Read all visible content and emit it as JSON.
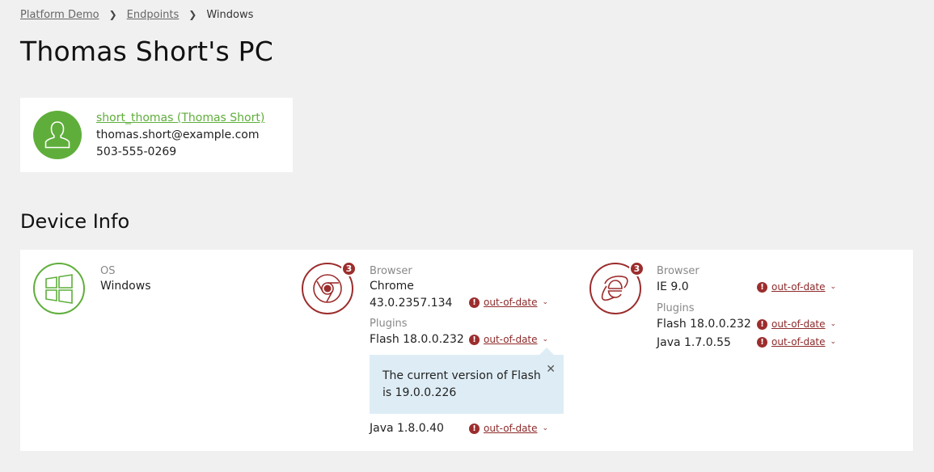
{
  "breadcrumb": {
    "items": [
      "Platform Demo",
      "Endpoints"
    ],
    "current": "Windows"
  },
  "page_title": "Thomas Short's PC",
  "user": {
    "link": "short_thomas (Thomas Short)",
    "email": "thomas.short@example.com",
    "phone": "503-555-0269",
    "avatar_icon": "user-silhouette-icon",
    "avatar_color": "#5fae3b"
  },
  "device_info": {
    "title": "Device Info",
    "os": {
      "label": "OS",
      "value": "Windows",
      "icon": "windows-icon"
    },
    "chrome": {
      "icon": "chrome-icon",
      "badge": "3",
      "browser_label": "Browser",
      "browser_name": "Chrome",
      "browser_version": "43.0.2357.134",
      "browser_status": "out-of-date",
      "plugins_label": "Plugins",
      "plugins": [
        {
          "name": "Flash 18.0.0.232",
          "status": "out-of-date"
        },
        {
          "name": "Java 1.8.0.40",
          "status": "out-of-date"
        }
      ],
      "tooltip": "The current version of Flash is 19.0.0.226"
    },
    "ie": {
      "icon": "internet-explorer-icon",
      "badge": "3",
      "browser_label": "Browser",
      "browser_value": "IE 9.0",
      "browser_status": "out-of-date",
      "plugins_label": "Plugins",
      "plugins": [
        {
          "name": "Flash 18.0.0.232",
          "status": "out-of-date"
        },
        {
          "name": "Java 1.7.0.55",
          "status": "out-of-date"
        }
      ]
    }
  },
  "colors": {
    "ok": "#5fae3b",
    "alert": "#9c2d2d",
    "tooltip_bg": "#deedf5"
  }
}
